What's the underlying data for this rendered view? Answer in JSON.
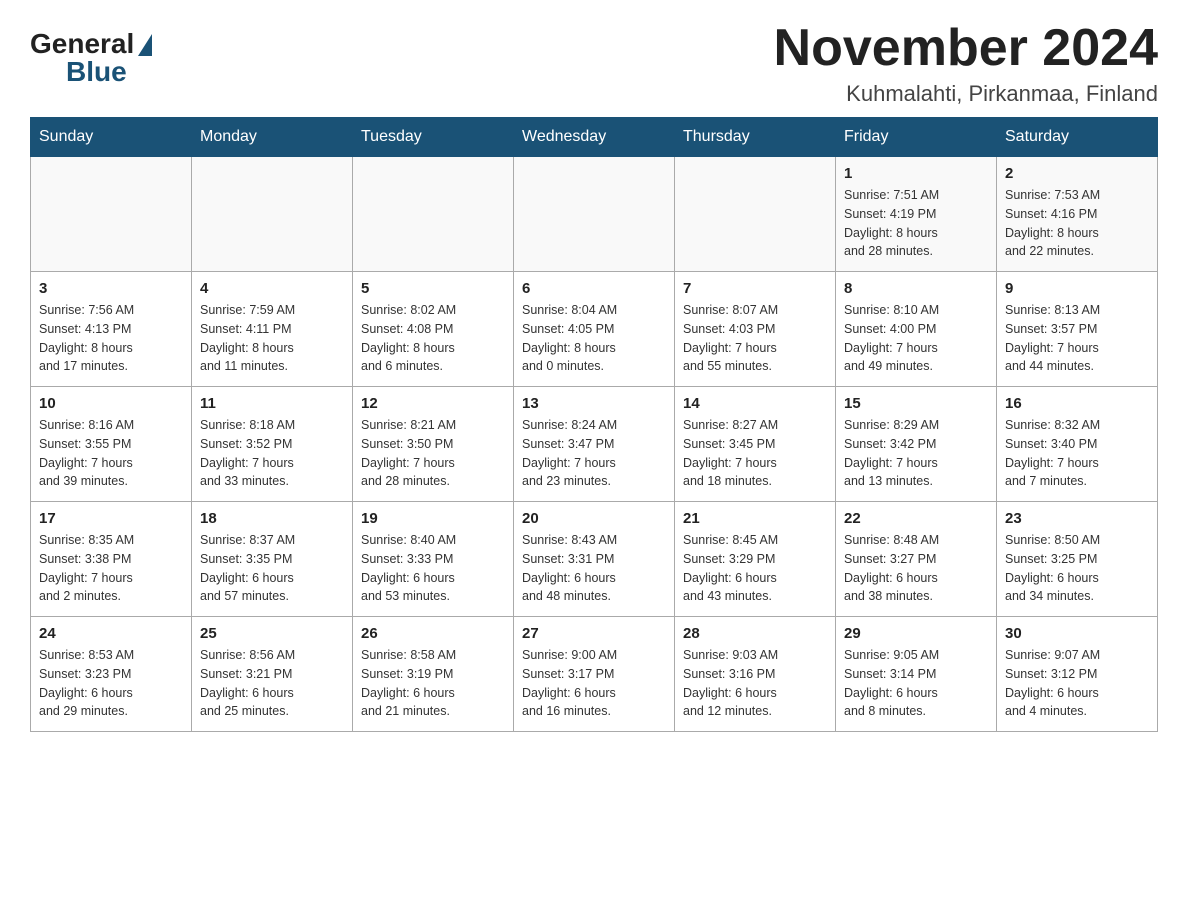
{
  "header": {
    "logo_general": "General",
    "logo_blue": "Blue",
    "month_title": "November 2024",
    "location": "Kuhmalahti, Pirkanmaa, Finland"
  },
  "weekdays": [
    "Sunday",
    "Monday",
    "Tuesday",
    "Wednesday",
    "Thursday",
    "Friday",
    "Saturday"
  ],
  "weeks": [
    [
      {
        "day": "",
        "info": ""
      },
      {
        "day": "",
        "info": ""
      },
      {
        "day": "",
        "info": ""
      },
      {
        "day": "",
        "info": ""
      },
      {
        "day": "",
        "info": ""
      },
      {
        "day": "1",
        "info": "Sunrise: 7:51 AM\nSunset: 4:19 PM\nDaylight: 8 hours\nand 28 minutes."
      },
      {
        "day": "2",
        "info": "Sunrise: 7:53 AM\nSunset: 4:16 PM\nDaylight: 8 hours\nand 22 minutes."
      }
    ],
    [
      {
        "day": "3",
        "info": "Sunrise: 7:56 AM\nSunset: 4:13 PM\nDaylight: 8 hours\nand 17 minutes."
      },
      {
        "day": "4",
        "info": "Sunrise: 7:59 AM\nSunset: 4:11 PM\nDaylight: 8 hours\nand 11 minutes."
      },
      {
        "day": "5",
        "info": "Sunrise: 8:02 AM\nSunset: 4:08 PM\nDaylight: 8 hours\nand 6 minutes."
      },
      {
        "day": "6",
        "info": "Sunrise: 8:04 AM\nSunset: 4:05 PM\nDaylight: 8 hours\nand 0 minutes."
      },
      {
        "day": "7",
        "info": "Sunrise: 8:07 AM\nSunset: 4:03 PM\nDaylight: 7 hours\nand 55 minutes."
      },
      {
        "day": "8",
        "info": "Sunrise: 8:10 AM\nSunset: 4:00 PM\nDaylight: 7 hours\nand 49 minutes."
      },
      {
        "day": "9",
        "info": "Sunrise: 8:13 AM\nSunset: 3:57 PM\nDaylight: 7 hours\nand 44 minutes."
      }
    ],
    [
      {
        "day": "10",
        "info": "Sunrise: 8:16 AM\nSunset: 3:55 PM\nDaylight: 7 hours\nand 39 minutes."
      },
      {
        "day": "11",
        "info": "Sunrise: 8:18 AM\nSunset: 3:52 PM\nDaylight: 7 hours\nand 33 minutes."
      },
      {
        "day": "12",
        "info": "Sunrise: 8:21 AM\nSunset: 3:50 PM\nDaylight: 7 hours\nand 28 minutes."
      },
      {
        "day": "13",
        "info": "Sunrise: 8:24 AM\nSunset: 3:47 PM\nDaylight: 7 hours\nand 23 minutes."
      },
      {
        "day": "14",
        "info": "Sunrise: 8:27 AM\nSunset: 3:45 PM\nDaylight: 7 hours\nand 18 minutes."
      },
      {
        "day": "15",
        "info": "Sunrise: 8:29 AM\nSunset: 3:42 PM\nDaylight: 7 hours\nand 13 minutes."
      },
      {
        "day": "16",
        "info": "Sunrise: 8:32 AM\nSunset: 3:40 PM\nDaylight: 7 hours\nand 7 minutes."
      }
    ],
    [
      {
        "day": "17",
        "info": "Sunrise: 8:35 AM\nSunset: 3:38 PM\nDaylight: 7 hours\nand 2 minutes."
      },
      {
        "day": "18",
        "info": "Sunrise: 8:37 AM\nSunset: 3:35 PM\nDaylight: 6 hours\nand 57 minutes."
      },
      {
        "day": "19",
        "info": "Sunrise: 8:40 AM\nSunset: 3:33 PM\nDaylight: 6 hours\nand 53 minutes."
      },
      {
        "day": "20",
        "info": "Sunrise: 8:43 AM\nSunset: 3:31 PM\nDaylight: 6 hours\nand 48 minutes."
      },
      {
        "day": "21",
        "info": "Sunrise: 8:45 AM\nSunset: 3:29 PM\nDaylight: 6 hours\nand 43 minutes."
      },
      {
        "day": "22",
        "info": "Sunrise: 8:48 AM\nSunset: 3:27 PM\nDaylight: 6 hours\nand 38 minutes."
      },
      {
        "day": "23",
        "info": "Sunrise: 8:50 AM\nSunset: 3:25 PM\nDaylight: 6 hours\nand 34 minutes."
      }
    ],
    [
      {
        "day": "24",
        "info": "Sunrise: 8:53 AM\nSunset: 3:23 PM\nDaylight: 6 hours\nand 29 minutes."
      },
      {
        "day": "25",
        "info": "Sunrise: 8:56 AM\nSunset: 3:21 PM\nDaylight: 6 hours\nand 25 minutes."
      },
      {
        "day": "26",
        "info": "Sunrise: 8:58 AM\nSunset: 3:19 PM\nDaylight: 6 hours\nand 21 minutes."
      },
      {
        "day": "27",
        "info": "Sunrise: 9:00 AM\nSunset: 3:17 PM\nDaylight: 6 hours\nand 16 minutes."
      },
      {
        "day": "28",
        "info": "Sunrise: 9:03 AM\nSunset: 3:16 PM\nDaylight: 6 hours\nand 12 minutes."
      },
      {
        "day": "29",
        "info": "Sunrise: 9:05 AM\nSunset: 3:14 PM\nDaylight: 6 hours\nand 8 minutes."
      },
      {
        "day": "30",
        "info": "Sunrise: 9:07 AM\nSunset: 3:12 PM\nDaylight: 6 hours\nand 4 minutes."
      }
    ]
  ]
}
